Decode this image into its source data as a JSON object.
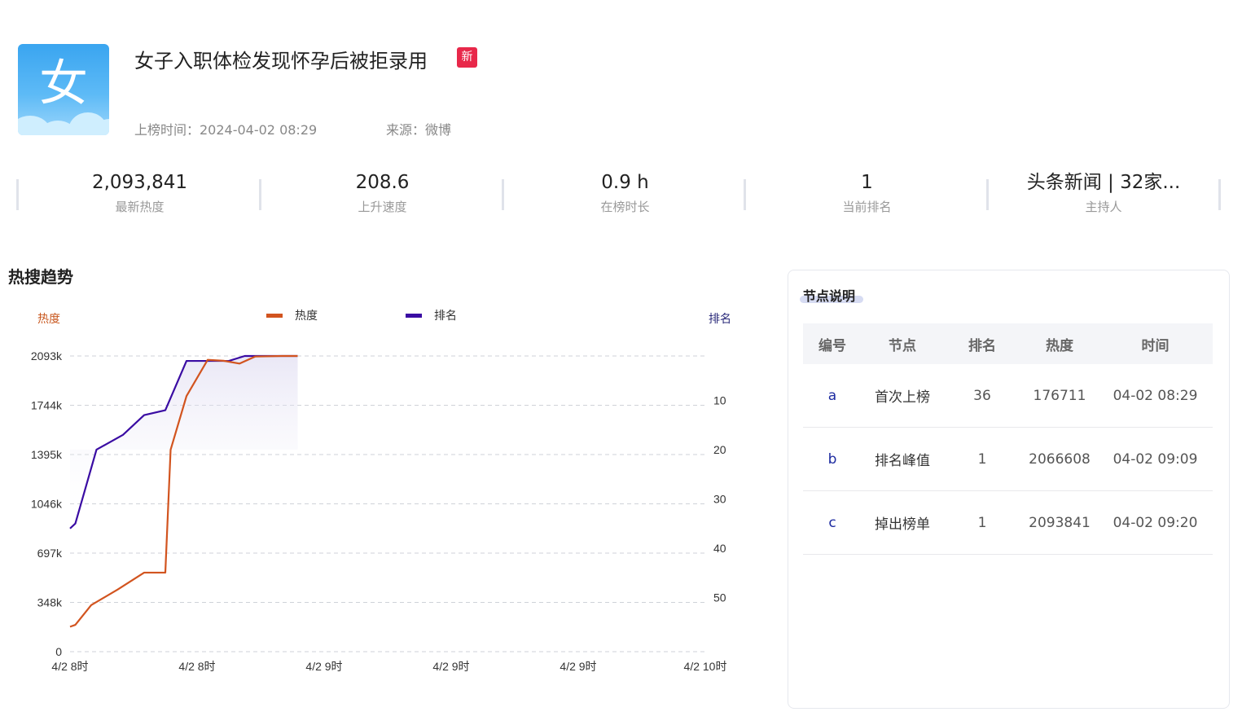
{
  "header": {
    "icon_char": "女",
    "title": "女子入职体检发现怀孕后被拒录用",
    "new_badge": "新",
    "listed_time": "上榜时间：2024-04-02 08:29",
    "source": "来源：微博"
  },
  "stats": [
    {
      "value": "2,093,841",
      "label": "最新热度"
    },
    {
      "value": "208.6",
      "label": "上升速度"
    },
    {
      "value": "0.9 h",
      "label": "在榜时长"
    },
    {
      "value": "1",
      "label": "当前排名"
    },
    {
      "value": "头条新闻 | 32家...",
      "label": "主持人"
    }
  ],
  "trend": {
    "section_title": "热搜趋势",
    "left_axis_label": "热度",
    "right_axis_label": "排名"
  },
  "chart_data": {
    "type": "line",
    "x_ticks": [
      "4/2 8时",
      "4/2 8时",
      "4/2 9时",
      "4/2 9时",
      "4/2 9时",
      "4/2 10时"
    ],
    "y_left_ticks": [
      "0",
      "348k",
      "697k",
      "1046k",
      "1395k",
      "1744k",
      "2093k"
    ],
    "y_right_ticks": [
      "10",
      "20",
      "30",
      "40",
      "50"
    ],
    "y_left_range": [
      0,
      2093841
    ],
    "y_right_range": [
      1,
      61
    ],
    "x_range_minutes": [
      0,
      120
    ],
    "legend": "top-center",
    "grid": true,
    "colors": {
      "heat": "#d2541f",
      "rank": "#3a0ca3"
    },
    "series": [
      {
        "name": "热度",
        "axis": "left",
        "x": [
          0,
          1,
          4,
          9,
          14,
          18,
          19,
          22,
          26,
          29,
          32,
          35,
          40,
          43
        ],
        "values": [
          176711,
          190000,
          330000,
          440000,
          560000,
          560000,
          1430000,
          1810000,
          2066608,
          2060000,
          2040000,
          2090000,
          2093841,
          2093841
        ]
      },
      {
        "name": "排名",
        "axis": "right",
        "x": [
          0,
          1,
          5,
          10,
          14,
          18,
          22,
          26,
          30,
          33,
          38,
          43
        ],
        "values": [
          36,
          35,
          20,
          17,
          13,
          12,
          2,
          2,
          2,
          1,
          1,
          1
        ]
      }
    ]
  },
  "nodes": {
    "title": "节点说明",
    "columns": [
      "编号",
      "节点",
      "排名",
      "热度",
      "时间"
    ],
    "rows": [
      [
        "a",
        "首次上榜",
        "36",
        "176711",
        "04-02 08:29"
      ],
      [
        "b",
        "排名峰值",
        "1",
        "2066608",
        "04-02 09:09"
      ],
      [
        "c",
        "掉出榜单",
        "1",
        "2093841",
        "04-02 09:20"
      ]
    ]
  }
}
